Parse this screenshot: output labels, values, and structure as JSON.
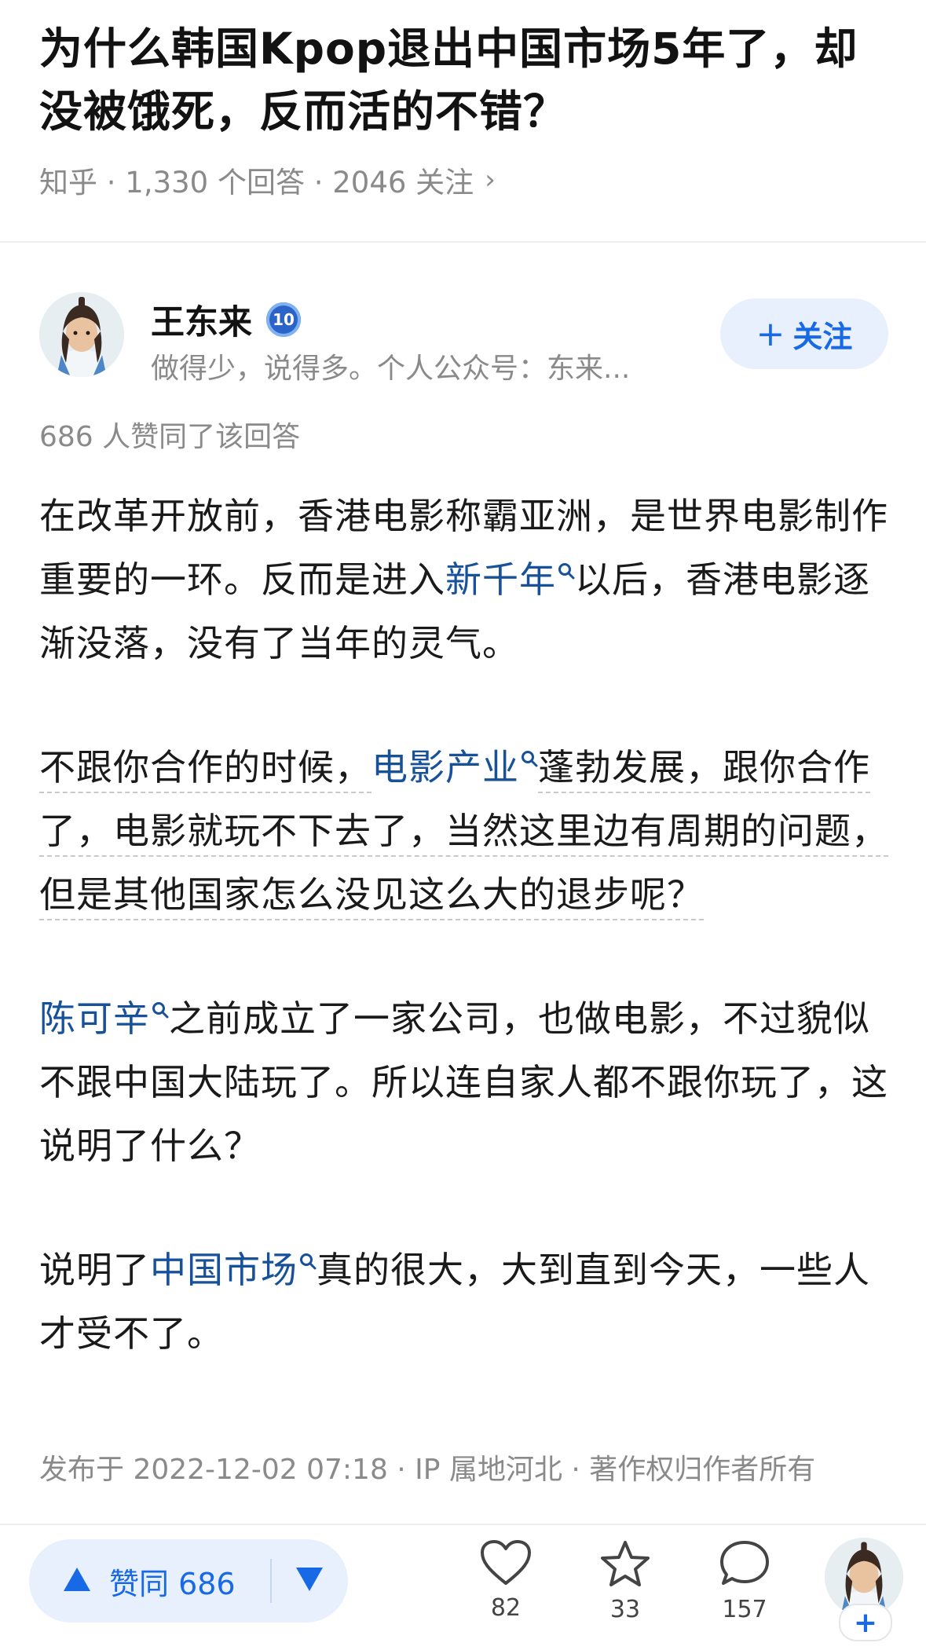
{
  "question": {
    "title": "为什么韩国Kpop退出中国市场5年了，却没被饿死，反而活的不错？",
    "meta": "知乎 · 1,330 个回答 · 2046 关注",
    "meta_chevron": "›"
  },
  "author": {
    "name": "王东来",
    "level": "10",
    "bio": "做得少，说得多。个人公众号：东来...",
    "follow_label": "关注",
    "follow_plus": "+"
  },
  "answer": {
    "agree_text": "686 人赞同了该回答",
    "p1": {
      "before": "在改革开放前，香港电影称霸亚洲，是世界电影制作重要的一环。反而是进入",
      "kw": "新千年",
      "after": "以后，香港电影逐渐没落，没有了当年的灵气。"
    },
    "p2": {
      "before": "不跟你合作的时候，",
      "kw": "电影产业",
      "after": "蓬勃发展，跟你合作了，电影就玩不下去了，当然这里边有周期的问题，但是其他国家怎么没见这么大的退步呢？"
    },
    "p3": {
      "kw": "陈可辛",
      "after": "之前成立了一家公司，也做电影，不过貌似不跟中国大陆玩了。所以连自家人都不跟你玩了，这说明了什么？"
    },
    "p4": {
      "before": "说明了",
      "kw": "中国市场",
      "after": "真的很大，大到直到今天，一些人才受不了。"
    },
    "footer": "发布于 2022-12-02 07:18 · IP 属地河北 · 著作权归作者所有"
  },
  "bottom_bar": {
    "vote_label": "赞同 686",
    "likes": "82",
    "favorites": "33",
    "comments": "157",
    "me_plus": "+"
  },
  "colors": {
    "accent": "#1769e6",
    "link": "#175199",
    "pill_bg": "#e8f0fd",
    "muted": "#8a8a8a"
  },
  "icons": [
    "chevron-right-icon",
    "level-badge-icon",
    "search-small-icon",
    "vote-up-icon",
    "vote-down-icon",
    "heart-icon",
    "star-icon",
    "comment-icon",
    "plus-icon"
  ]
}
